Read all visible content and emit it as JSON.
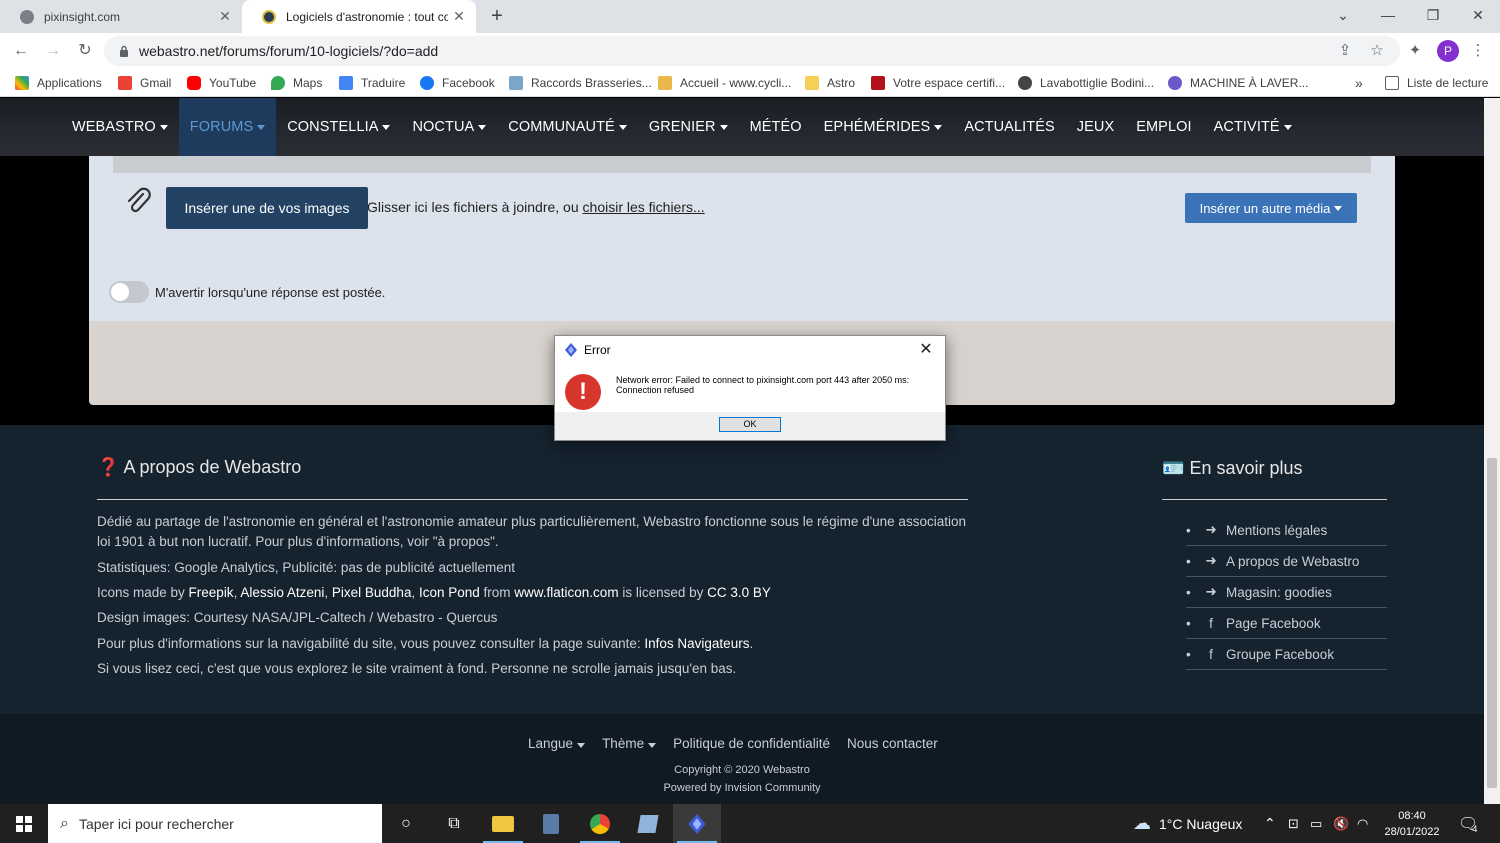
{
  "browser": {
    "tabs": [
      {
        "title": "pixinsight.com"
      },
      {
        "title": "Logiciels d'astronomie : tout com"
      }
    ],
    "url": "webastro.net/forums/forum/10-logiciels/?do=add",
    "profile_initial": "P",
    "bookmarks": [
      "Applications",
      "Gmail",
      "YouTube",
      "Maps",
      "Traduire",
      "Facebook",
      "Raccords Brasseries...",
      "Accueil - www.cycli...",
      "Astro",
      "Votre espace certifi...",
      "Lavabottiglie Bodini...",
      "MACHINE À LAVER..."
    ],
    "reading_list": "Liste de lecture"
  },
  "site_nav": [
    {
      "label": "WEBASTRO",
      "caret": true
    },
    {
      "label": "FORUMS",
      "caret": true
    },
    {
      "label": "CONSTELLIA",
      "caret": true
    },
    {
      "label": "NOCTUA",
      "caret": true
    },
    {
      "label": "COMMUNAUTÉ",
      "caret": true
    },
    {
      "label": "GRENIER",
      "caret": true
    },
    {
      "label": "MÉTÉO",
      "caret": false
    },
    {
      "label": "EPHÉMÉRIDES",
      "caret": true
    },
    {
      "label": "ACTUALITÉS",
      "caret": false
    },
    {
      "label": "JEUX",
      "caret": false
    },
    {
      "label": "EMPLOI",
      "caret": false
    },
    {
      "label": "ACTIVITÉ",
      "caret": true
    }
  ],
  "editor": {
    "insert_images": "Insérer une de vos images",
    "drop_text": "Glisser ici les fichiers à joindre, ou ",
    "choose_files": "choisir les fichiers...",
    "insert_media": "Insérer un autre média",
    "notify_label": "M'avertir lorsqu'une réponse est postée."
  },
  "dialog": {
    "title": "Error",
    "message": "Network error: Failed to connect to pixinsight.com port 443 after 2050 ms: Connection refused",
    "ok": "OK"
  },
  "footer": {
    "about_title": "A propos de Webastro",
    "about_text": "Dédié au partage de l'astronomie en général et l'astronomie amateur plus particulièrement, Webastro fonctionne sous le régime d'une association loi 1901 à but non lucratif. Pour plus d'informations, voir \"à propos\".",
    "stats": "Statistiques:   Google Analytics, Publicité: pas de publicité actuellement",
    "icons_prefix": "Icons made by ",
    "icons_authors": [
      "Freepik",
      "Alessio Atzeni",
      "Pixel Buddha",
      "Icon Pond"
    ],
    "icons_from": " from ",
    "icons_site": "www.flaticon.com",
    "icons_licensed": " is licensed by ",
    "icons_license": "CC 3.0 BY",
    "design": "Design images: Courtesy NASA/JPL-Caltech / Webastro - Quercus",
    "nav_info_prefix": "Pour plus d'informations sur la navigabilité du site, vous pouvez consulter la page suivante: ",
    "nav_info_link": "Infos Navigateurs",
    "easter": "Si vous lisez ceci, c'est que vous explorez le site vraiment à fond. Personne ne scrolle jamais jusqu'en bas.",
    "more_title": "En savoir plus",
    "more_items": [
      {
        "label": "Mentions légales",
        "icon": "arrow-circle-icon"
      },
      {
        "label": "A propos de Webastro",
        "icon": "arrow-circle-icon"
      },
      {
        "label": "Magasin: goodies",
        "icon": "arrow-circle-icon"
      },
      {
        "label": "Page Facebook",
        "icon": "facebook-icon"
      },
      {
        "label": "Groupe Facebook",
        "icon": "facebook-icon"
      }
    ],
    "bottom_links": [
      {
        "label": "Langue",
        "caret": true
      },
      {
        "label": "Thème",
        "caret": true
      },
      {
        "label": "Politique de confidentialité",
        "caret": false
      },
      {
        "label": "Nous contacter",
        "caret": false
      }
    ],
    "copyright": "Copyright © 2020 Webastro",
    "powered": "Powered by Invision Community"
  },
  "taskbar": {
    "search_placeholder": "Taper ici pour rechercher",
    "weather": "1°C  Nuageux",
    "time": "08:40",
    "date": "28/01/2022",
    "notif_count": "4"
  }
}
